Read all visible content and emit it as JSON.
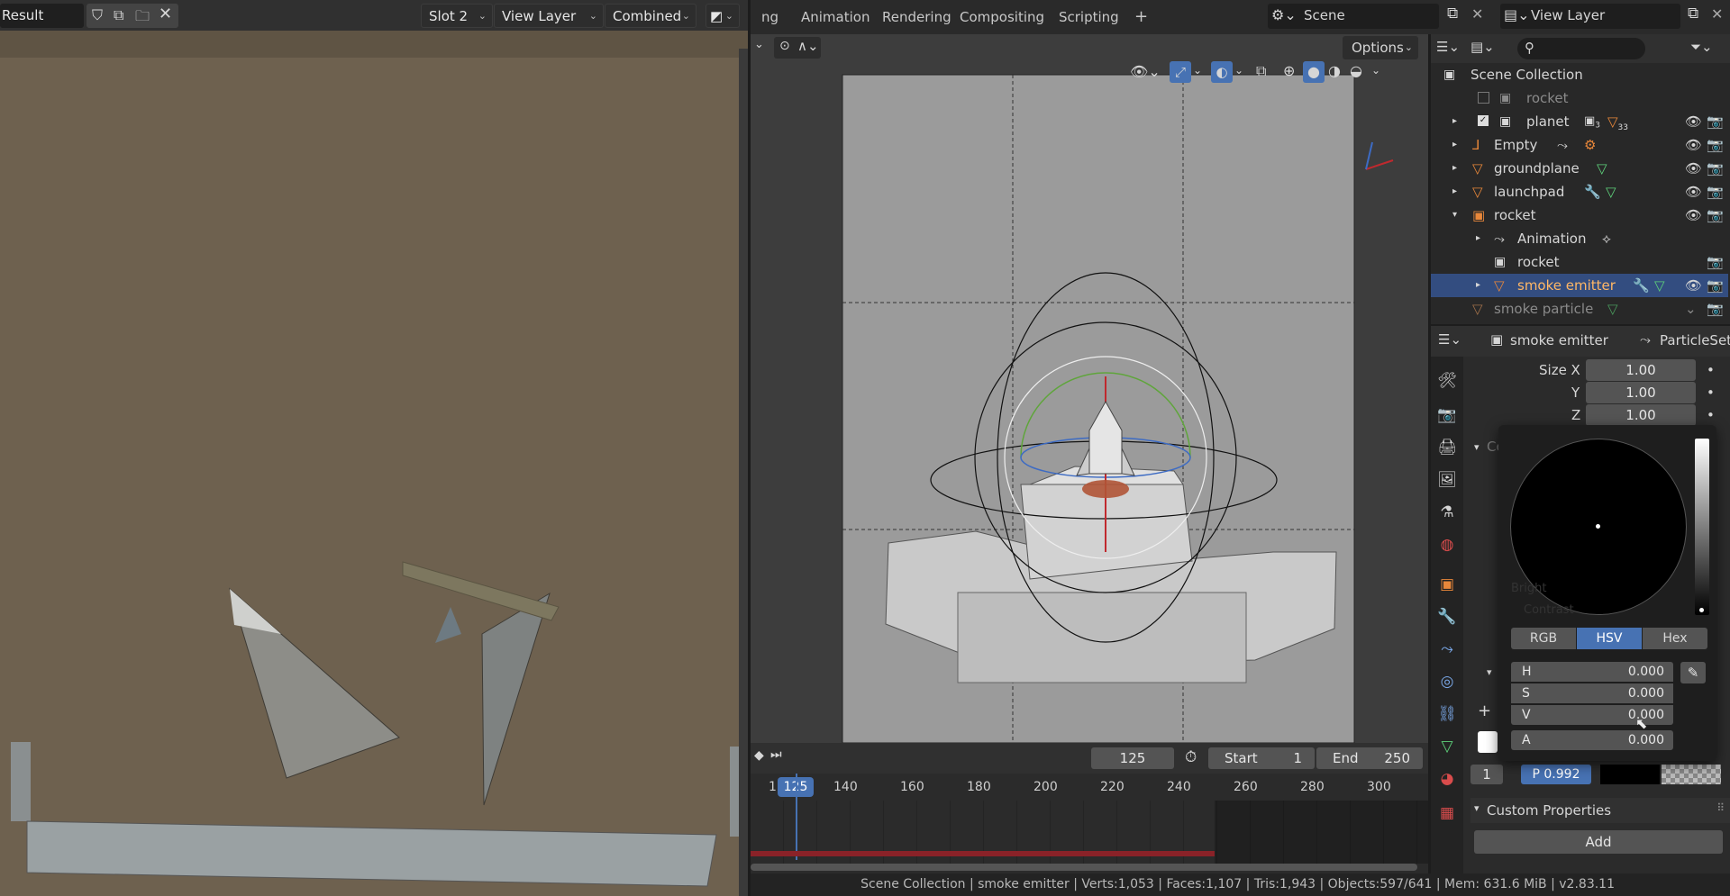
{
  "image_editor": {
    "image_name": "Result",
    "slot": "Slot 2",
    "view_layer": "View Layer",
    "pass": "Combined"
  },
  "workspace_tabs": [
    "ng",
    "Animation",
    "Rendering",
    "Compositing",
    "Scripting",
    "+"
  ],
  "scene_name": "Scene",
  "view_layer_name": "View Layer",
  "viewport": {
    "options_label": "Options"
  },
  "outliner": {
    "root": "Scene Collection",
    "items": [
      {
        "label": "rocket"
      },
      {
        "label": "planet",
        "badge1": "3",
        "badge2": "33"
      },
      {
        "label": "Empty"
      },
      {
        "label": "groundplane"
      },
      {
        "label": "launchpad"
      },
      {
        "label": "rocket"
      },
      {
        "label": "Animation"
      },
      {
        "label": "rocket"
      },
      {
        "label": "smoke emitter"
      },
      {
        "label": "smoke particle"
      }
    ]
  },
  "properties": {
    "object_name": "smoke emitter",
    "particle_settings": "ParticleSet",
    "size_x_label": "Size X",
    "size_x": "1.00",
    "y_label": "Y",
    "y": "1.00",
    "z_label": "Z",
    "z": "1.00",
    "colors_label": "Colors",
    "custom_properties_label": "Custom Properties",
    "add_label": "Add",
    "slot_index": "1",
    "p_value": "P 0.992"
  },
  "color_picker": {
    "modes": [
      "RGB",
      "HSV",
      "Hex"
    ],
    "active_mode": "HSV",
    "h_label": "H",
    "h": "0.000",
    "s_label": "S",
    "s": "0.000",
    "v_label": "V",
    "v": "0.000",
    "a_label": "A",
    "a": "0.000",
    "hidden_text_1": "Bright",
    "hidden_text_2": "Contrast"
  },
  "timeline": {
    "current_frame": "125",
    "start_label": "Start",
    "start": "1",
    "end_label": "End",
    "end": "250",
    "ticks": [
      "1",
      "140",
      "160",
      "180",
      "200",
      "220",
      "240",
      "260",
      "280",
      "300"
    ],
    "playhead": "125"
  },
  "status_bar": "Scene Collection | smoke emitter | Verts:1,053 | Faces:1,107 | Tris:1,943 | Objects:597/641 | Mem: 631.6 MiB | v2.83.11",
  "colors": {
    "accent": "#4772b3",
    "orange": "#e8873a",
    "green": "#5ed17a",
    "active_row": "#334d80",
    "playhead_red": "#c0292e"
  }
}
